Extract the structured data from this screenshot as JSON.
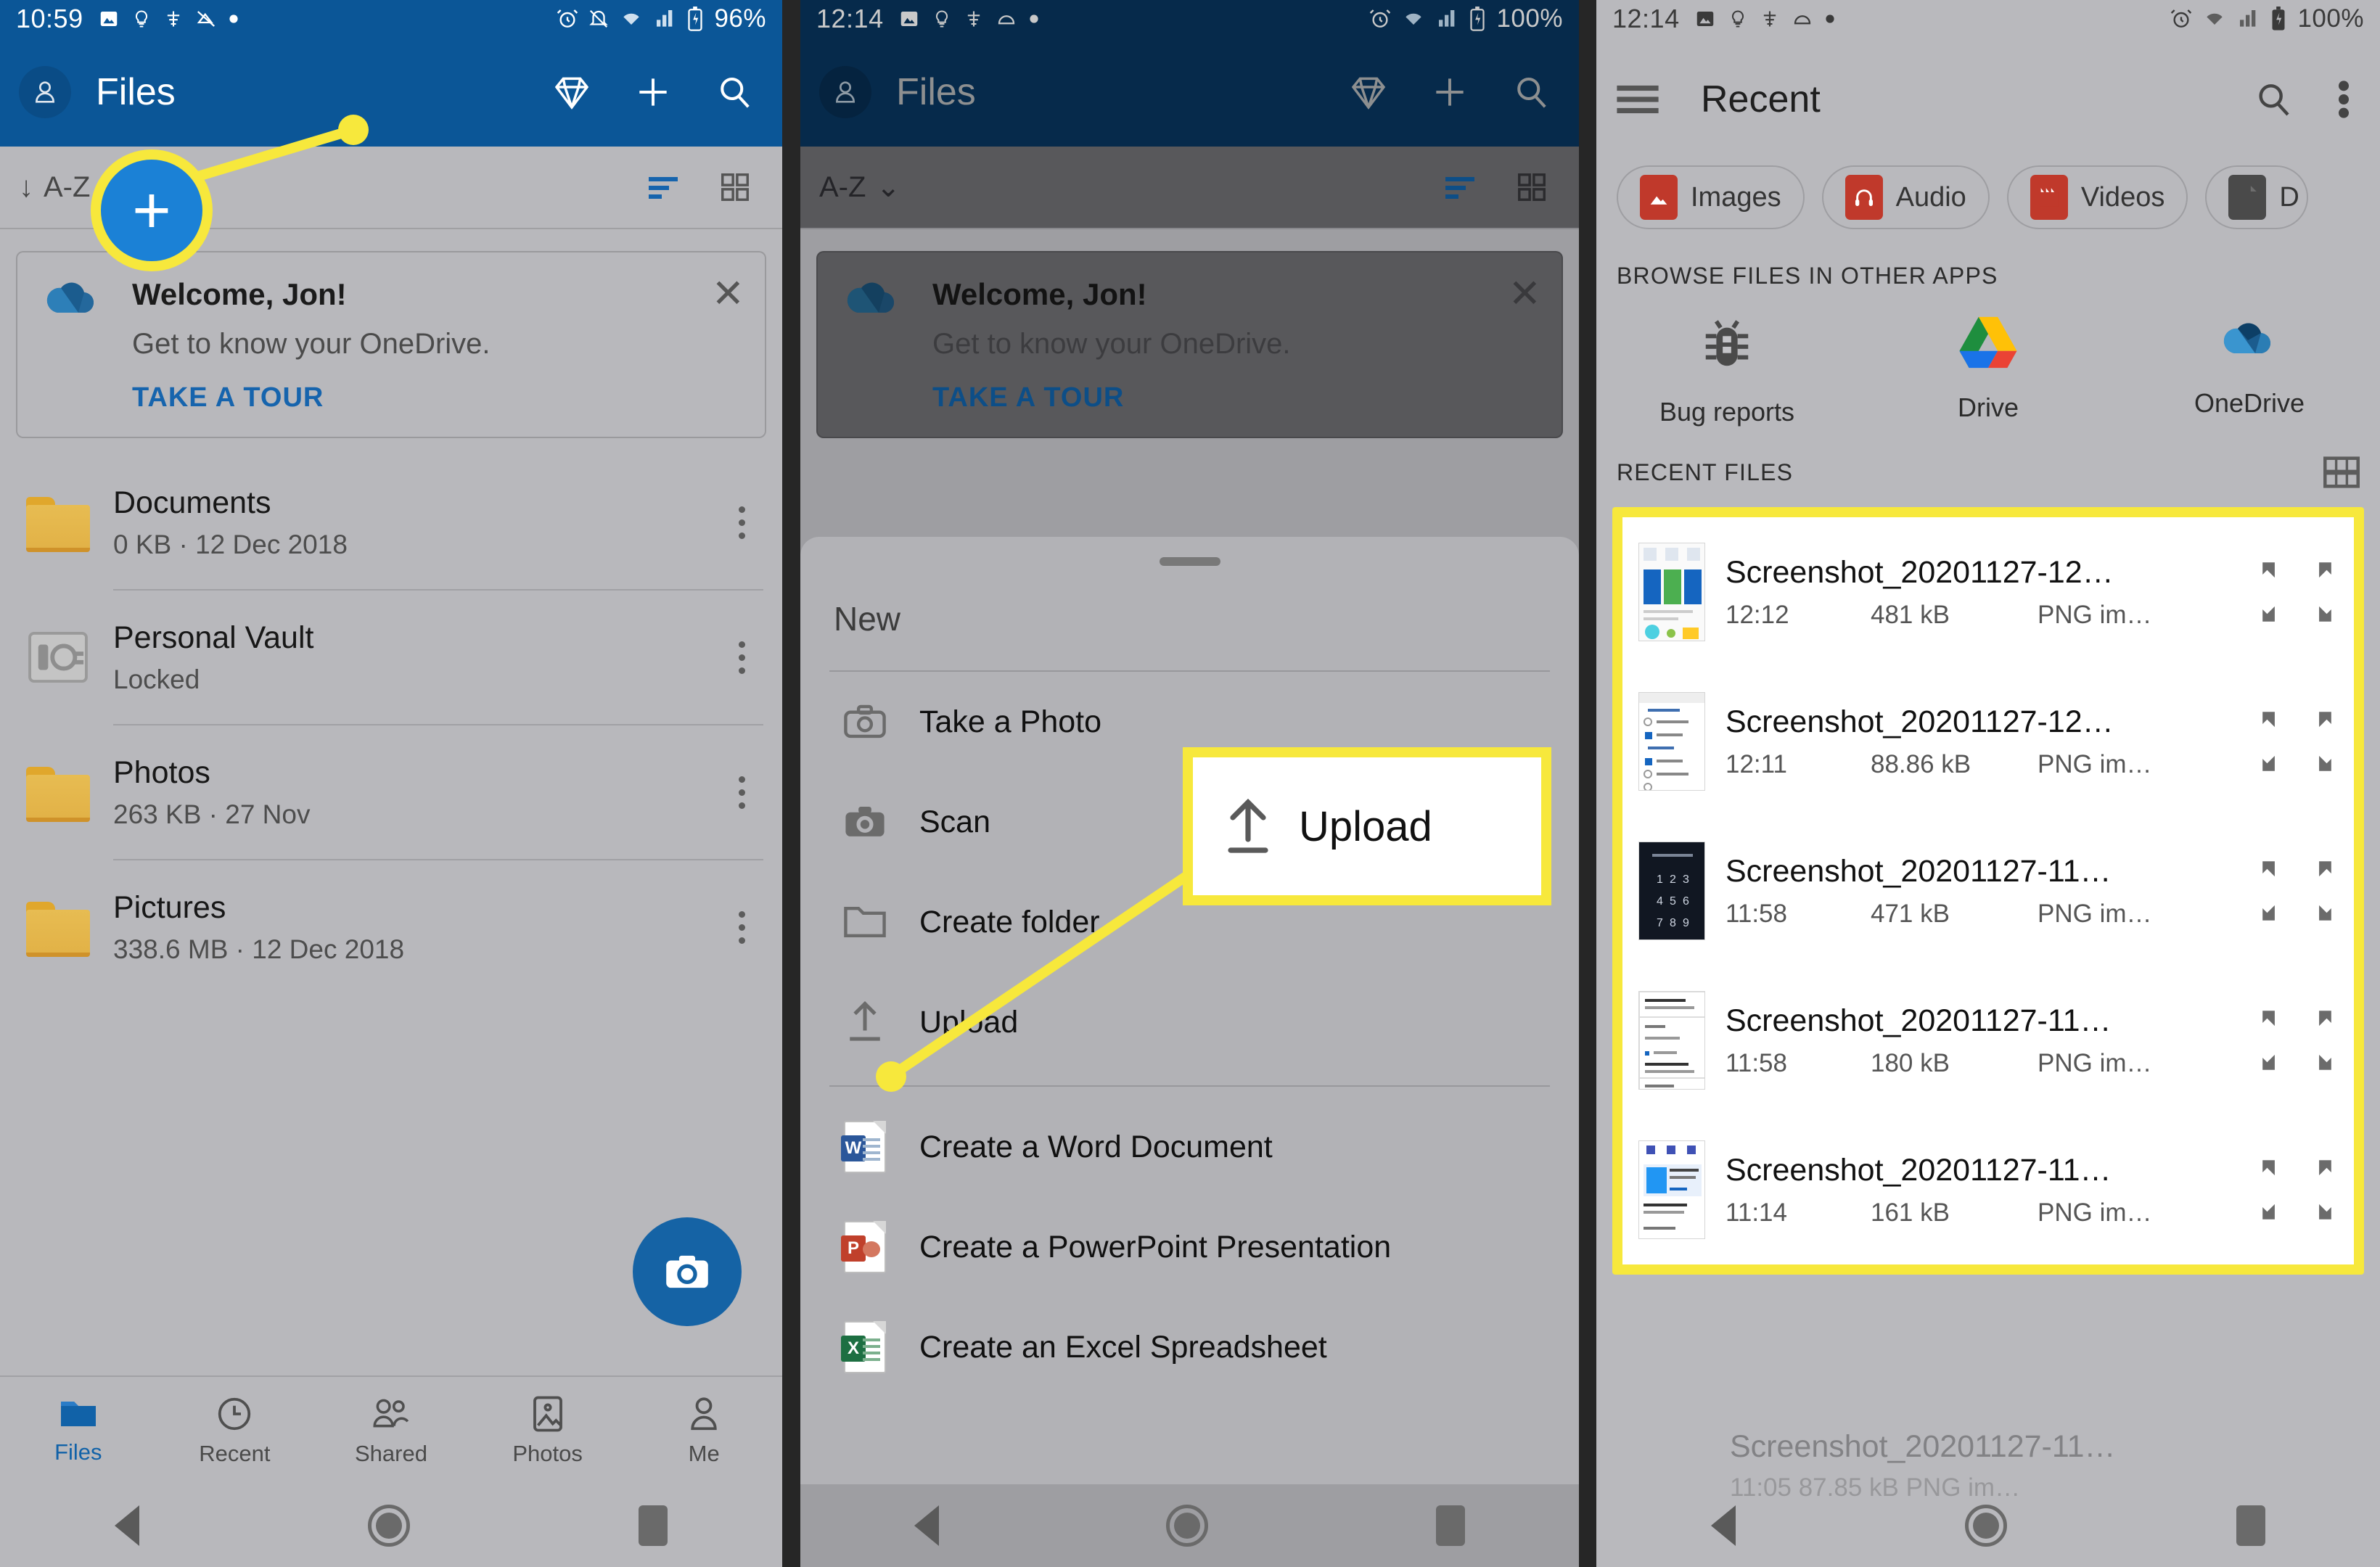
{
  "panels": {
    "left": {
      "status": {
        "time": "10:59",
        "battery": "96%",
        "icons": [
          "image-icon",
          "lightbulb-icon",
          "signal-slash-icon",
          "mute-icon",
          "dot-icon",
          "alarm-icon",
          "notifications-off-icon",
          "wifi-icon",
          "cellular-icon",
          "battery-icon"
        ]
      },
      "appbar": {
        "title": "Files",
        "avatar": "account-avatar",
        "actions": [
          "premium-diamond-icon",
          "add-icon",
          "search-icon"
        ]
      },
      "sortbar": {
        "label": "A-Z",
        "arrow": "↓",
        "actions": [
          "sort-list-icon",
          "grid-view-icon"
        ]
      },
      "welcome": {
        "title": "Welcome, Jon!",
        "subtitle": "Get to know your OneDrive.",
        "cta": "TAKE A TOUR",
        "close": "✕"
      },
      "files": [
        {
          "name": "Documents",
          "meta": "0 KB · 12 Dec 2018",
          "icon": "folder-icon"
        },
        {
          "name": "Personal Vault",
          "meta": "Locked",
          "icon": "vault-icon"
        },
        {
          "name": "Photos",
          "meta": "263 KB · 27 Nov",
          "icon": "folder-icon"
        },
        {
          "name": "Pictures",
          "meta": "338.6 MB · 12 Dec 2018",
          "icon": "folder-icon"
        }
      ],
      "fab": "camera-fab",
      "tabs": [
        {
          "label": "Files",
          "icon": "folder-icon",
          "active": true
        },
        {
          "label": "Recent",
          "icon": "clock-icon",
          "active": false
        },
        {
          "label": "Shared",
          "icon": "people-icon",
          "active": false
        },
        {
          "label": "Photos",
          "icon": "photo-icon",
          "active": false
        },
        {
          "label": "Me",
          "icon": "person-icon",
          "active": false
        }
      ]
    },
    "middle": {
      "status": {
        "time": "12:14",
        "battery": "100%"
      },
      "appbar": {
        "title": "Files"
      },
      "sortbar": {
        "label": "A-Z",
        "chevron": "⌄"
      },
      "welcome": {
        "title": "Welcome, Jon!",
        "subtitle": "Get to know your OneDrive.",
        "cta": "TAKE A TOUR",
        "close": "✕"
      },
      "sheet": {
        "title": "New",
        "items": [
          {
            "label": "Take a Photo",
            "icon": "camera-outline-icon"
          },
          {
            "label": "Scan",
            "icon": "scan-camera-icon"
          },
          {
            "label": "Create folder",
            "icon": "folder-outline-icon"
          },
          {
            "label": "Upload",
            "icon": "upload-arrow-icon"
          },
          {
            "label": "Create a Word Document",
            "icon": "word-doc-icon"
          },
          {
            "label": "Create a PowerPoint Presentation",
            "icon": "powerpoint-doc-icon"
          },
          {
            "label": "Create an Excel Spreadsheet",
            "icon": "excel-doc-icon"
          }
        ]
      }
    },
    "right": {
      "status": {
        "time": "12:14",
        "battery": "100%"
      },
      "appbar": {
        "title": "Recent",
        "menu_icon": "hamburger-icon",
        "actions": [
          "search-icon",
          "overflow-menu-icon"
        ]
      },
      "chips": [
        {
          "label": "Images",
          "icon": "images-icon",
          "color": "#c0392b"
        },
        {
          "label": "Audio",
          "icon": "audio-icon",
          "color": "#c0392b"
        },
        {
          "label": "Videos",
          "icon": "videos-icon",
          "color": "#c0392b"
        },
        {
          "label": "D",
          "icon": "document-icon",
          "color": "#4a4a4a"
        }
      ],
      "browse_heading": "BROWSE FILES IN OTHER APPS",
      "apps": [
        {
          "label": "Bug reports",
          "icon": "bug-icon"
        },
        {
          "label": "Drive",
          "icon": "google-drive-icon"
        },
        {
          "label": "OneDrive",
          "icon": "onedrive-icon"
        }
      ],
      "recent_heading": "RECENT FILES",
      "recent_grid_icon": "grid-view-icon",
      "recent_files": [
        {
          "name": "Screenshot_20201127-12…",
          "time": "12:12",
          "size": "481 kB",
          "type": "PNG im…"
        },
        {
          "name": "Screenshot_20201127-12…",
          "time": "12:11",
          "size": "88.86 kB",
          "type": "PNG im…"
        },
        {
          "name": "Screenshot_20201127-11…",
          "time": "11:58",
          "size": "471 kB",
          "type": "PNG im…"
        },
        {
          "name": "Screenshot_20201127-11…",
          "time": "11:58",
          "size": "180 kB",
          "type": "PNG im…"
        },
        {
          "name": "Screenshot_20201127-11…",
          "time": "11:14",
          "size": "161 kB",
          "type": "PNG im…"
        }
      ],
      "ghost_row": {
        "name": "Screenshot_20201127-11…",
        "meta": "11:05   87.85 kB   PNG im…"
      }
    }
  },
  "annotations": {
    "plus_highlight": {
      "glyph": "+",
      "target": "add-button"
    },
    "upload_callout": {
      "label": "Upload",
      "icon": "upload-arrow-icon"
    }
  },
  "navbar": {
    "back": "back-icon",
    "home": "home-icon",
    "recents": "recents-icon"
  },
  "colors": {
    "brand_blue": "#0b5697",
    "highlight_yellow": "#f7e83c",
    "fab_blue": "#1563a5"
  }
}
